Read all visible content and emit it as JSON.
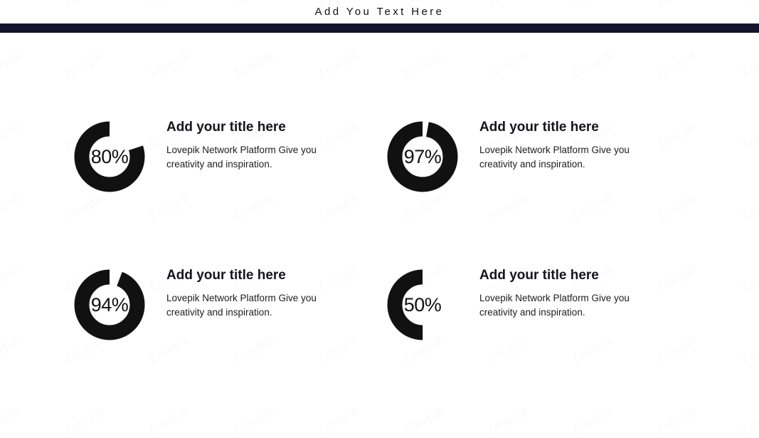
{
  "header": {
    "title": "Add You Text Here",
    "rule_color": "#15152b"
  },
  "colors": {
    "arc": "#111111",
    "track": "#ffffff",
    "text": "#15151c",
    "accent": "#15152b"
  },
  "watermark": {
    "text": "Lovepik"
  },
  "items": [
    {
      "value_label": "80%",
      "percent": 80,
      "title": "Add your title here",
      "description": "Lovepik Network Platform Give you creativity and inspiration."
    },
    {
      "value_label": "97%",
      "percent": 97,
      "title": "Add your title here",
      "description": "Lovepik Network Platform Give you creativity and inspiration."
    },
    {
      "value_label": "94%",
      "percent": 94,
      "title": "Add your title here",
      "description": "Lovepik Network Platform Give you creativity and inspiration."
    },
    {
      "value_label": "50%",
      "percent": 50,
      "title": "Add your title here",
      "description": "Lovepik Network Platform Give you creativity and inspiration."
    }
  ],
  "chart_data": {
    "type": "pie",
    "title": "Add You Text Here",
    "subtitle": "",
    "xlabel": "",
    "ylabel": "",
    "legend_position": "right",
    "grid": false,
    "chart_style": "donut-progress",
    "categories": [
      "Add your title here",
      "Add your title here",
      "Add your title here",
      "Add your title here"
    ],
    "values": [
      80,
      97,
      94,
      50
    ],
    "value_labels": [
      "80%",
      "97%",
      "94%",
      "50%"
    ],
    "unit": "%",
    "ylim": [
      0,
      100
    ],
    "annotations": [
      "Lovepik Network Platform Give you creativity and inspiration.",
      "Lovepik Network Platform Give you creativity and inspiration.",
      "Lovepik Network Platform Give you creativity and inspiration.",
      "Lovepik Network Platform Give you creativity and inspiration."
    ]
  }
}
